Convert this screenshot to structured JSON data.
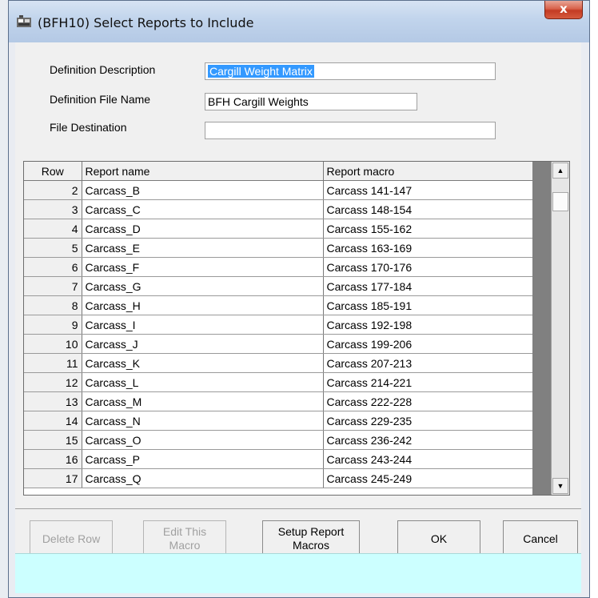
{
  "window": {
    "title": "(BFH10)  Select Reports to Include",
    "close_label": "x"
  },
  "form": {
    "definition_description_label": "Definition Description",
    "definition_description_value": "Cargill Weight Matrix",
    "definition_file_name_label": "Definition File Name",
    "definition_file_name_value": "BFH Cargill Weights",
    "file_destination_label": "File Destination",
    "file_destination_value": ""
  },
  "grid": {
    "columns": [
      "Row",
      "Report name",
      "Report macro"
    ],
    "rows": [
      {
        "row": "2",
        "name": "Carcass_B",
        "macro": "Carcass 141-147"
      },
      {
        "row": "3",
        "name": "Carcass_C",
        "macro": "Carcass 148-154"
      },
      {
        "row": "4",
        "name": "Carcass_D",
        "macro": "Carcass 155-162"
      },
      {
        "row": "5",
        "name": "Carcass_E",
        "macro": "Carcass 163-169"
      },
      {
        "row": "6",
        "name": "Carcass_F",
        "macro": "Carcass 170-176"
      },
      {
        "row": "7",
        "name": "Carcass_G",
        "macro": "Carcass 177-184"
      },
      {
        "row": "8",
        "name": "Carcass_H",
        "macro": "Carcass 185-191"
      },
      {
        "row": "9",
        "name": "Carcass_I",
        "macro": "Carcass 192-198"
      },
      {
        "row": "10",
        "name": "Carcass_J",
        "macro": "Carcass 199-206"
      },
      {
        "row": "11",
        "name": "Carcass_K",
        "macro": "Carcass 207-213"
      },
      {
        "row": "12",
        "name": "Carcass_L",
        "macro": "Carcass 214-221"
      },
      {
        "row": "13",
        "name": "Carcass_M",
        "macro": "Carcass 222-228"
      },
      {
        "row": "14",
        "name": "Carcass_N",
        "macro": "Carcass 229-235"
      },
      {
        "row": "15",
        "name": "Carcass_O",
        "macro": "Carcass 236-242"
      },
      {
        "row": "16",
        "name": "Carcass_P",
        "macro": "Carcass 243-244"
      },
      {
        "row": "17",
        "name": "Carcass_Q",
        "macro": "Carcass 245-249"
      }
    ]
  },
  "buttons": {
    "delete_row": "Delete Row",
    "edit_macro_line1": "Edit This",
    "edit_macro_line2": "Macro",
    "setup_macros_line1": "Setup Report",
    "setup_macros_line2": "Macros",
    "ok": "OK",
    "cancel": "Cancel"
  }
}
